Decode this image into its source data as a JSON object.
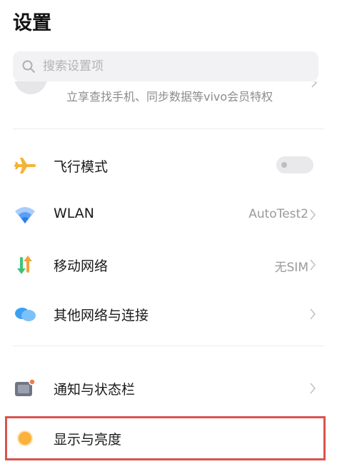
{
  "header": {
    "title": "设置"
  },
  "search": {
    "placeholder": "搜索设置项",
    "icon": "search-icon"
  },
  "account": {
    "subtitle": "立享查找手机、同步数据等vivo会员特权"
  },
  "items": [
    {
      "label": "飞行模式",
      "value": "",
      "icon": "airplane-icon",
      "toggle": {
        "on": false
      }
    },
    {
      "label": "WLAN",
      "value": "AutoTest2",
      "icon": "wifi-icon"
    },
    {
      "label": "移动网络",
      "value": "无SIM",
      "icon": "mobile-data-icon"
    },
    {
      "label": "其他网络与连接",
      "value": "",
      "icon": "connections-icon"
    },
    {
      "label": "通知与状态栏",
      "value": "",
      "icon": "notification-icon"
    },
    {
      "label": "显示与亮度",
      "value": "",
      "icon": "display-brightness-icon"
    }
  ],
  "colors": {
    "airplane": "#f5b335",
    "wifi": "#3f8ef5",
    "mobile_up": "#f2a33a",
    "mobile_down": "#3cc47a",
    "connections": "#3ba0f5",
    "display": "#fbb13c",
    "highlight": "#d9534f"
  }
}
